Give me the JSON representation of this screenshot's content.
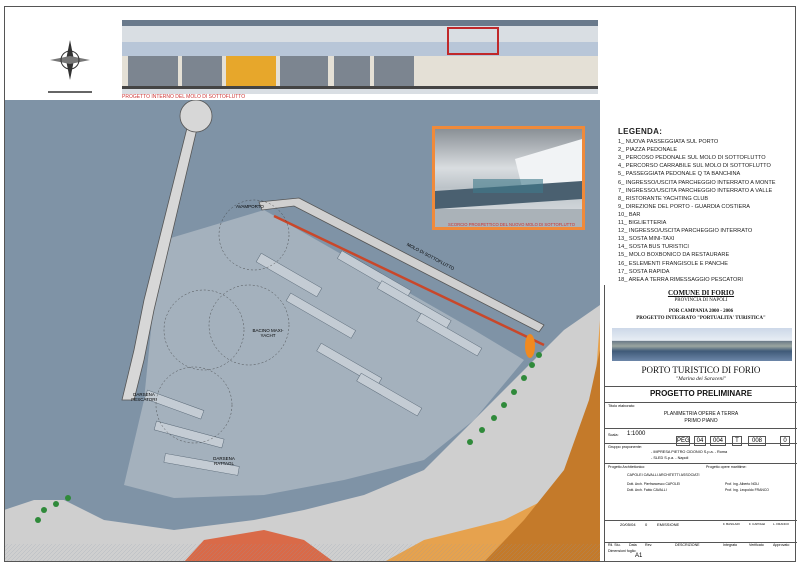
{
  "elevation_caption": "PROGETTO INTERNO DEL MOLO DI SOTTOFLUTTO",
  "render_caption": "SCORCIO PROSPETTICO DEL NUOVO MOLO DI SOTTOFLUTTO",
  "plan_labels": {
    "avamporto": "AVAMPORTO",
    "molo_sottoflutto": "MOLO DI SOTTOFLUTTO",
    "bacino": "BACINO MAXI-YACHT",
    "darsena": "DARSENA RATTAGL",
    "darsena_pescatori": "DARSENA PESCATORI"
  },
  "legend": {
    "title": "LEGENDA:",
    "items": [
      "1_ NUOVA PASSEGGIATA SUL PORTO",
      "2_ PIAZZA PEDONALE",
      "3_ PERCOSO PEDONALE SUL MOLO DI SOTTOFLUTTO",
      "4_ PERCORSO CARRABILE SUL MOLO DI SOTTOFLUTTO",
      "5_ PASSEGGIATA PEDONALE Q TA BANCHINA",
      "6_ INGRESSO/USCITA PARCHEGGIO INTERRATO A MONTE",
      "7_ INGRESSO/USCITA PARCHEGGIO INTERRATO A VALLE",
      "8_ RISTORANTE YACHTING CLUB",
      "9_ DIREZIONE DEL PORTO - GUARDIA COSTIERA",
      "10_ BAR",
      "11_ BIGLIETTERIA",
      "12_ INGRESSO/USCITA PARCHEGGIO INTERRATO",
      "13_ SOSTA MINI-TAXI",
      "14_ SOSTA BUS TURISTICI",
      "15_ MOLO BOXBONICO DA RESTAURARE",
      "16_ ESLEMENTI FRANGISOLE E PANCHE",
      "17_ SOSTA RAPIDA",
      "18_ AREA A TERRA RIMESSAGGIO PESCATORI"
    ]
  },
  "title_block": {
    "comune": "COMUNE DI FORIO",
    "provincia": "PROVINCIA DI NAPOLI",
    "por": "POR CAMPANIA 2000 - 2006",
    "progetto_integrato": "PROGETTO INTEGRATO \"PORTUALITA' TURISTICA\"",
    "porto": "PORTO TURISTICO DI FORIO",
    "marina": "\"Marina dei Saraceni\"",
    "fase": "PROGETTO PRELIMINARE",
    "titolo_label": "Titolo elaborato:",
    "titolo": "PLANIMETRIA OPERE A TERRA",
    "sottotitolo": "PRIMO PIANO",
    "scala_label": "Scala:",
    "scala": "1:1000",
    "codes": [
      "PEG",
      "04",
      "004",
      "T",
      "008",
      "0"
    ],
    "proponente_label": "Gruppo proponente:",
    "proponenti": [
      "- IMPRESA PIETRO CIDONIO S.p.a. - Roma",
      "- SLED S.p.a. - Napoli"
    ],
    "architettonico_label": "Progetto Architettonico:",
    "studio": "CAPOLEI CAVALLI ARCHITETTI ASSOCIATI",
    "arch": "Dott. Arch. Pierfrancesco CAPOLEI",
    "arch2": "Dott. Arch. Fabio CAVALLI",
    "marittime_label": "Progetto opere marittime:",
    "ing1": "Prof. Ing. Alberto NOLI",
    "ing2": "Prof. Ing. Leopoldo FRANCO",
    "rev_date": "20/05/04",
    "rev_num": "0",
    "rev_desc": "EMISSIONE",
    "rev_cols": [
      "Ril. Stu.",
      "Data",
      "Rev.",
      "DESCRIZIONE",
      "Integrato",
      "Verificato",
      "Approvato"
    ],
    "signers": [
      "F. BASILARI",
      "F. CAPOLEI",
      "L. FRANCO"
    ],
    "dim_label": "Dimensioni foglio:",
    "dim": "A1"
  }
}
